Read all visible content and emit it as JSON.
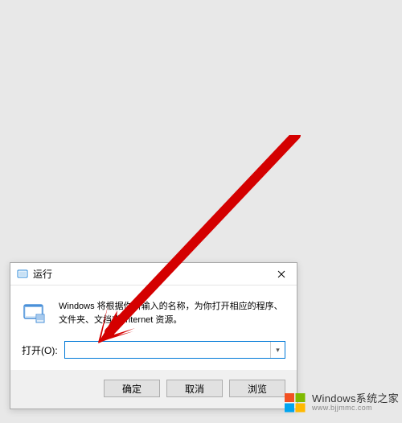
{
  "dialog": {
    "title": "运行",
    "description": "Windows 将根据你所输入的名称，为你打开相应的程序、文件夹、文档或 Internet 资源。",
    "open_label": "打开(O):",
    "input_value": "",
    "buttons": {
      "ok": "确定",
      "cancel": "取消",
      "browse": "浏览"
    }
  },
  "branding": {
    "title": "Windows系统之家",
    "url": "www.bjjmmc.com"
  }
}
